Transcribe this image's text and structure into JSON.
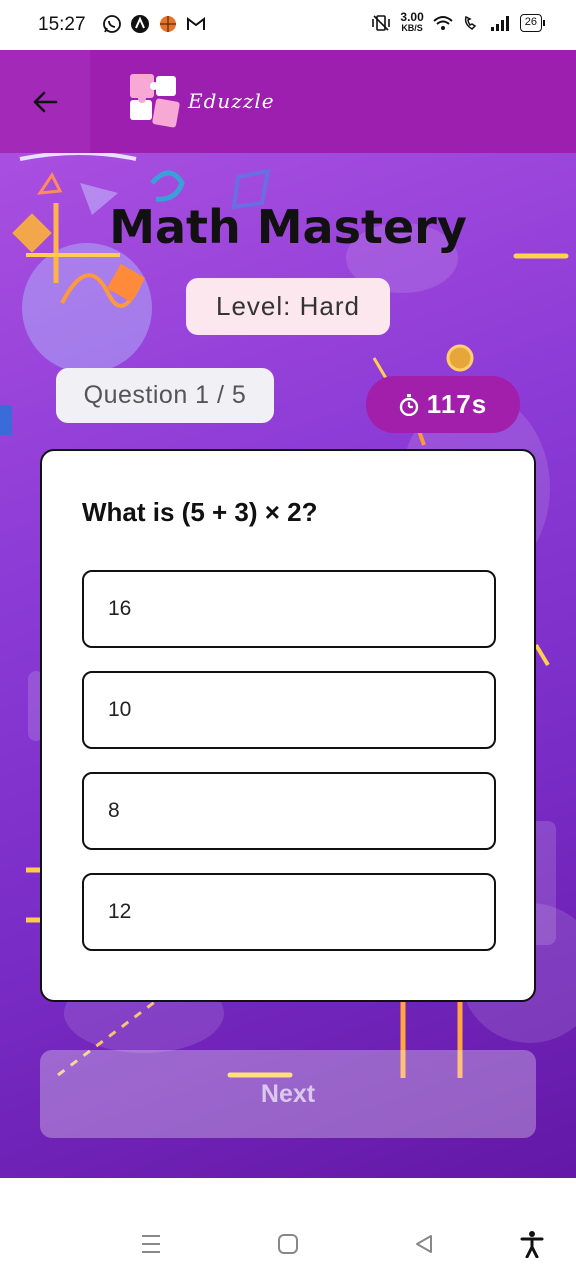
{
  "status_bar": {
    "time": "15:27",
    "net_speed_value": "3.00",
    "net_speed_unit": "KB/S",
    "battery": "26"
  },
  "header": {
    "app_name": "Eduzzle"
  },
  "quiz": {
    "title": "Math Mastery",
    "level": "Level: Hard",
    "question_counter": "Question 1 / 5",
    "timer": "117s",
    "question": "What is (5 + 3) × 2?",
    "options": [
      "16",
      "10",
      "8",
      "12"
    ],
    "next_label": "Next"
  },
  "colors": {
    "header": "#9c1fb0",
    "timer_pill": "#a21fac",
    "level_pill": "#fde7ef",
    "gradient_start": "#a94fe0",
    "gradient_end": "#6418a6"
  }
}
